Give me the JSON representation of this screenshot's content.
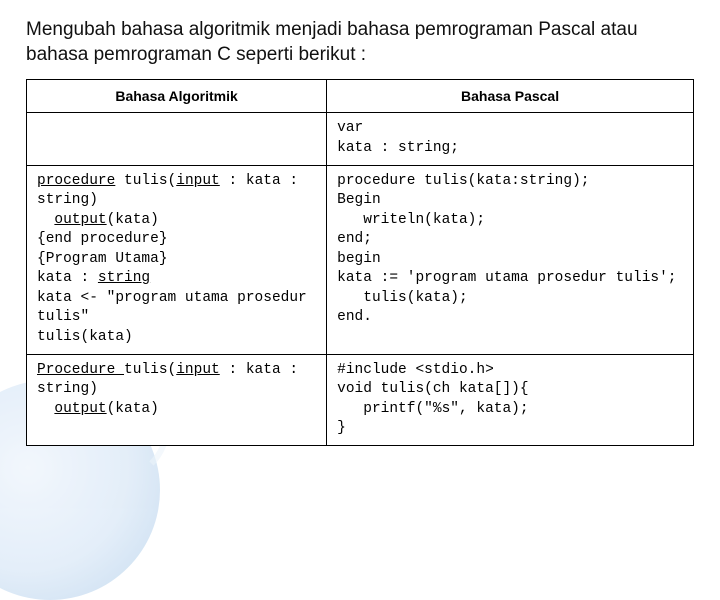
{
  "title": "Mengubah bahasa algoritmik menjadi bahasa pemrograman Pascal atau bahasa pemrograman C seperti berikut :",
  "table": {
    "headers": [
      "Bahasa Algoritmik",
      "Bahasa Pascal"
    ],
    "rows": [
      {
        "left": "",
        "right": "var\nkata : string;"
      },
      {
        "left_parts": {
          "p1": "procedure",
          "p2": " tulis(",
          "p3": "input",
          "p4": " : kata : string)",
          "out1": "output",
          "out2": "(kata)",
          "endp": "{end procedure}",
          "pu": "{Program Utama}",
          "kdecl1": "kata : ",
          "kdecl2": "string",
          "kb": "kata <- \"program utama prosedur tulis\"",
          "call": "tulis(kata)"
        },
        "right": "procedure tulis(kata:string);\nBegin\n   writeln(kata);\nend;\nbegin\nkata := 'program utama prosedur tulis';\n   tulis(kata);\nend."
      },
      {
        "left_parts": {
          "p1": "Procedure ",
          "p2": "tulis(",
          "p3": "input",
          "p4": " : kata : string)",
          "out1": "output",
          "out2": "(kata)"
        },
        "right": "#include <stdio.h>\nvoid tulis(ch kata[]){\n   printf(\"%s\", kata);\n}"
      }
    ]
  }
}
